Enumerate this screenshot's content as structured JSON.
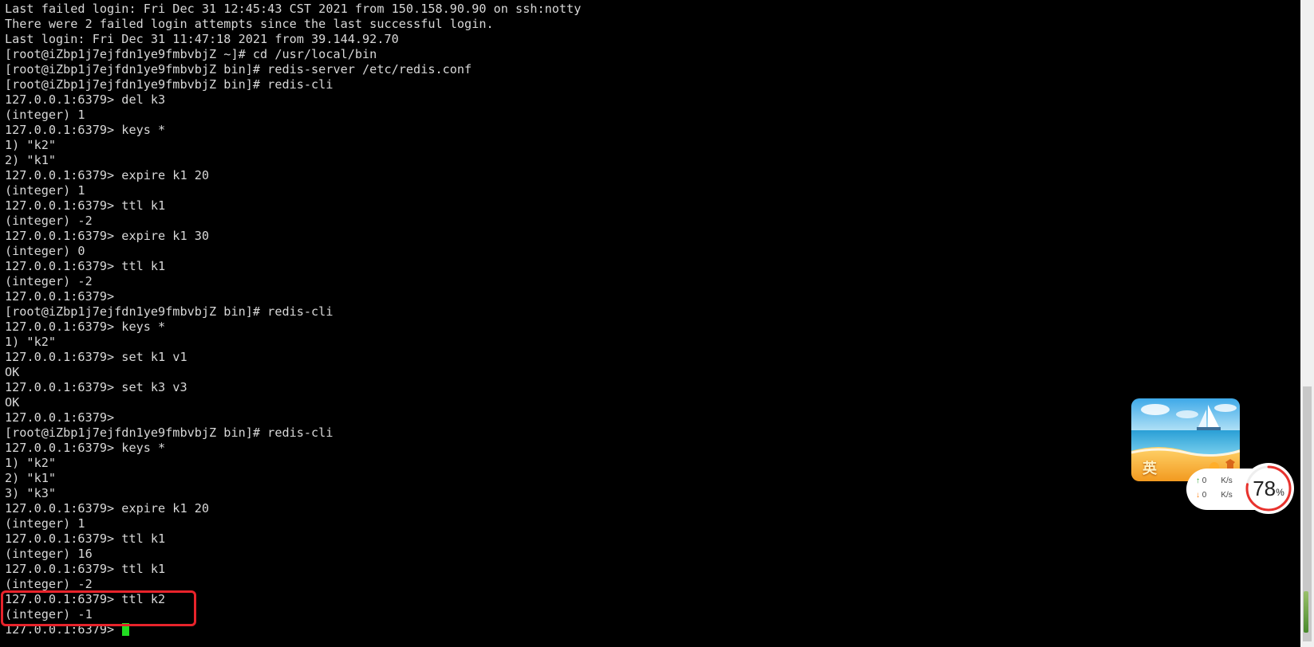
{
  "terminal": {
    "lines": [
      "Last failed login: Fri Dec 31 12:45:43 CST 2021 from 150.158.90.90 on ssh:notty",
      "There were 2 failed login attempts since the last successful login.",
      "Last login: Fri Dec 31 11:47:18 2021 from 39.144.92.70",
      "[root@iZbp1j7ejfdn1ye9fmbvbjZ ~]# cd /usr/local/bin",
      "[root@iZbp1j7ejfdn1ye9fmbvbjZ bin]# redis-server /etc/redis.conf",
      "[root@iZbp1j7ejfdn1ye9fmbvbjZ bin]# redis-cli",
      "127.0.0.1:6379> del k3",
      "(integer) 1",
      "127.0.0.1:6379> keys *",
      "1) \"k2\"",
      "2) \"k1\"",
      "127.0.0.1:6379> expire k1 20",
      "(integer) 1",
      "127.0.0.1:6379> ttl k1",
      "(integer) -2",
      "127.0.0.1:6379> expire k1 30",
      "(integer) 0",
      "127.0.0.1:6379> ttl k1",
      "(integer) -2",
      "127.0.0.1:6379>",
      "[root@iZbp1j7ejfdn1ye9fmbvbjZ bin]# redis-cli",
      "127.0.0.1:6379> keys *",
      "1) \"k2\"",
      "127.0.0.1:6379> set k1 v1",
      "OK",
      "127.0.0.1:6379> set k3 v3",
      "OK",
      "127.0.0.1:6379>",
      "[root@iZbp1j7ejfdn1ye9fmbvbjZ bin]# redis-cli",
      "127.0.0.1:6379> keys *",
      "1) \"k2\"",
      "2) \"k1\"",
      "3) \"k3\"",
      "127.0.0.1:6379> expire k1 20",
      "(integer) 1",
      "127.0.0.1:6379> ttl k1",
      "(integer) 16",
      "127.0.0.1:6379> ttl k1",
      "(integer) -2",
      "127.0.0.1:6379> ttl k2",
      "(integer) -1"
    ],
    "prompt": "127.0.0.1:6379> ",
    "cursor_color": "#22dd22",
    "highlight_color": "#e8232b"
  },
  "widget": {
    "ime_label": "英",
    "net_up": "0",
    "net_down": "0",
    "net_unit": "K/s",
    "cpu_value": "78",
    "cpu_unit": "%",
    "cpu_ring_color": "#e8322d"
  }
}
